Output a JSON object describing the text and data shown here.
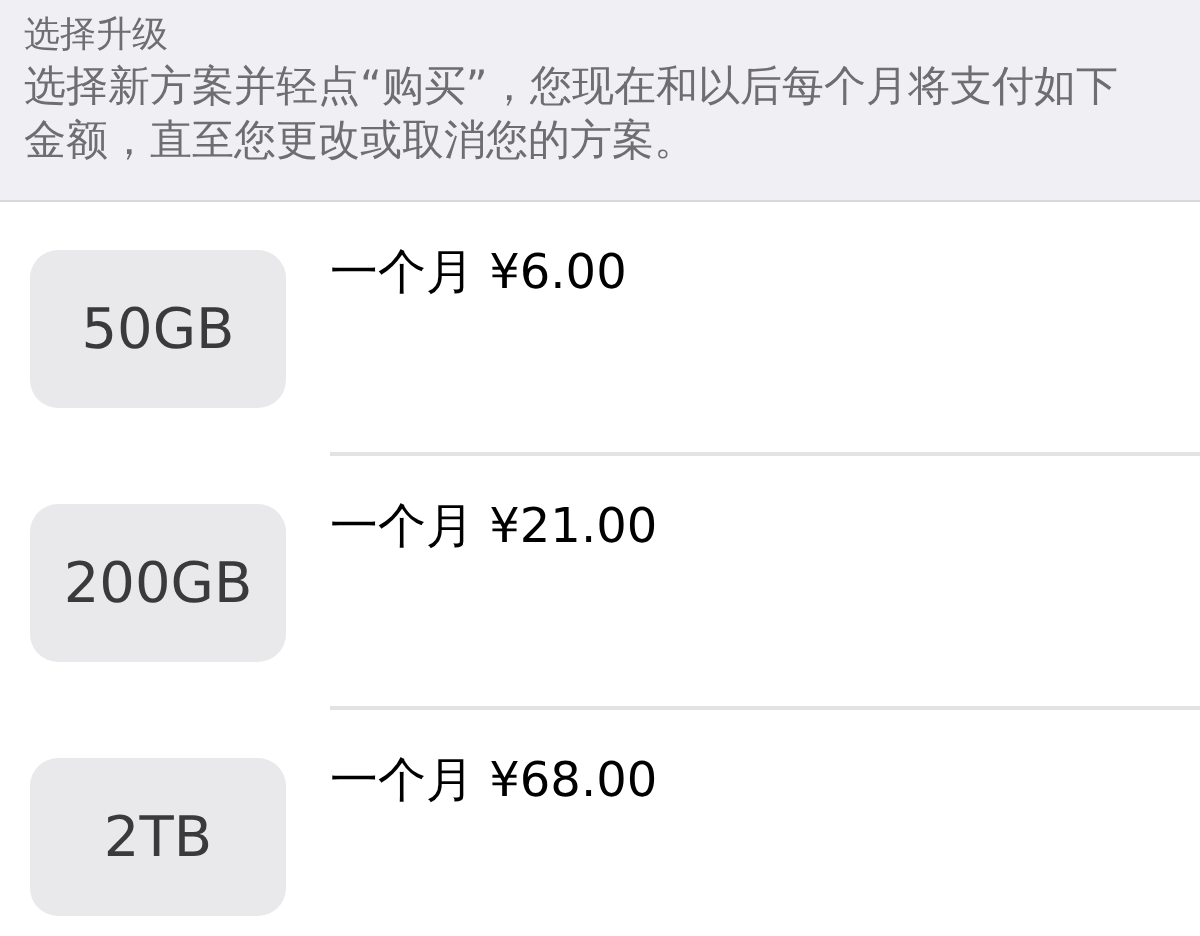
{
  "header": {
    "title": "选择升级",
    "description": "选择新方案并轻点“购买”，您现在和以后每个月将支付如下金额，直至您更改或取消您的方案。"
  },
  "plans": [
    {
      "size": "50GB",
      "price": "一个月 ¥6.00"
    },
    {
      "size": "200GB",
      "price": "一个月 ¥21.00"
    },
    {
      "size": "2TB",
      "price": "一个月 ¥68.00"
    }
  ]
}
